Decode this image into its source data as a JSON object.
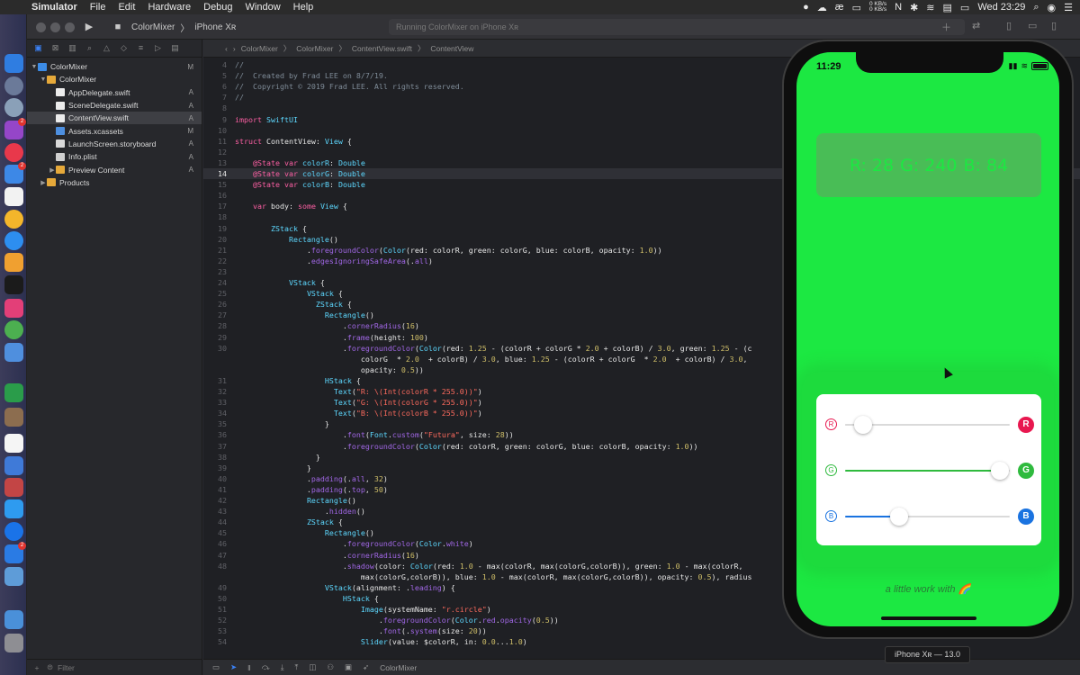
{
  "menubar": {
    "app_name": "Simulator",
    "items": [
      "File",
      "Edit",
      "Hardware",
      "Debug",
      "Window",
      "Help"
    ],
    "net_up": "0 KB/s",
    "net_down": "0 KB/s",
    "clock": "Wed 23:29"
  },
  "toolbar": {
    "scheme": "ColorMixer",
    "device": "iPhone Xʀ",
    "activity": "Running ColorMixer on iPhone Xʀ"
  },
  "navigator": {
    "filter_placeholder": "Filter",
    "items": [
      {
        "name": "ColorMixer",
        "status": "M"
      },
      {
        "name": "ColorMixer",
        "status": ""
      },
      {
        "name": "AppDelegate.swift",
        "status": "A"
      },
      {
        "name": "SceneDelegate.swift",
        "status": "A"
      },
      {
        "name": "ContentView.swift",
        "status": "A"
      },
      {
        "name": "Assets.xcassets",
        "status": "M"
      },
      {
        "name": "LaunchScreen.storyboard",
        "status": "A"
      },
      {
        "name": "Info.plist",
        "status": "A"
      },
      {
        "name": "Preview Content",
        "status": "A"
      },
      {
        "name": "Products",
        "status": ""
      }
    ]
  },
  "jumpbar": {
    "crumbs": [
      "ColorMixer",
      "ColorMixer",
      "ContentView.swift",
      "ContentView"
    ]
  },
  "editor": {
    "current_line": "14",
    "lines": [
      {
        "n": "4",
        "t": "//"
      },
      {
        "n": "5",
        "t": "//  Created by Frad LEE on 8/7/19."
      },
      {
        "n": "6",
        "t": "//  Copyright © 2019 Frad LEE. All rights reserved."
      },
      {
        "n": "7",
        "t": "//"
      },
      {
        "n": "8",
        "t": ""
      },
      {
        "n": "9",
        "t": "import SwiftUI"
      },
      {
        "n": "10",
        "t": ""
      },
      {
        "n": "11",
        "t": "struct ContentView: View {"
      },
      {
        "n": "12",
        "t": ""
      },
      {
        "n": "13",
        "t": "    @State var colorR: Double"
      },
      {
        "n": "14",
        "t": "    @State var colorG: Double"
      },
      {
        "n": "15",
        "t": "    @State var colorB: Double"
      },
      {
        "n": "16",
        "t": ""
      },
      {
        "n": "17",
        "t": "    var body: some View {"
      },
      {
        "n": "18",
        "t": ""
      },
      {
        "n": "19",
        "t": "        ZStack {"
      },
      {
        "n": "20",
        "t": "            Rectangle()"
      },
      {
        "n": "21",
        "t": "                .foregroundColor(Color(red: colorR, green: colorG, blue: colorB, opacity: 1.0))"
      },
      {
        "n": "22",
        "t": "                .edgesIgnoringSafeArea(.all)"
      },
      {
        "n": "23",
        "t": ""
      },
      {
        "n": "24",
        "t": "            VStack {"
      },
      {
        "n": "25",
        "t": "                VStack {"
      },
      {
        "n": "26",
        "t": "                  ZStack {"
      },
      {
        "n": "27",
        "t": "                    Rectangle()"
      },
      {
        "n": "28",
        "t": "                        .cornerRadius(16)"
      },
      {
        "n": "29",
        "t": "                        .frame(height: 100)"
      },
      {
        "n": "30",
        "t": "                        .foregroundColor(Color(red: 1.25 - (colorR + colorG * 2.0 + colorB) / 3.0, green: 1.25 - (c"
      },
      {
        "n": "",
        "t": "                            colorG  * 2.0  + colorB) / 3.0, blue: 1.25 - (colorR + colorG  * 2.0  + colorB) / 3.0,"
      },
      {
        "n": "",
        "t": "                            opacity: 0.5))"
      },
      {
        "n": "31",
        "t": "                    HStack {"
      },
      {
        "n": "32",
        "t": "                      Text(\"R: \\(Int(colorR * 255.0))\")"
      },
      {
        "n": "33",
        "t": "                      Text(\"G: \\(Int(colorG * 255.0))\")"
      },
      {
        "n": "34",
        "t": "                      Text(\"B: \\(Int(colorB * 255.0))\")"
      },
      {
        "n": "35",
        "t": "                    }"
      },
      {
        "n": "36",
        "t": "                        .font(Font.custom(\"Futura\", size: 28))"
      },
      {
        "n": "37",
        "t": "                        .foregroundColor(Color(red: colorR, green: colorG, blue: colorB, opacity: 1.0))"
      },
      {
        "n": "38",
        "t": "                  }"
      },
      {
        "n": "39",
        "t": "                }"
      },
      {
        "n": "40",
        "t": "                .padding(.all, 32)"
      },
      {
        "n": "41",
        "t": "                .padding(.top, 50)"
      },
      {
        "n": "42",
        "t": "                Rectangle()"
      },
      {
        "n": "43",
        "t": "                    .hidden()"
      },
      {
        "n": "44",
        "t": "                ZStack {"
      },
      {
        "n": "45",
        "t": "                    Rectangle()"
      },
      {
        "n": "46",
        "t": "                        .foregroundColor(Color.white)"
      },
      {
        "n": "47",
        "t": "                        .cornerRadius(16)"
      },
      {
        "n": "48",
        "t": "                        .shadow(color: Color(red: 1.0 - max(colorR, max(colorG,colorB)), green: 1.0 - max(colorR,"
      },
      {
        "n": "",
        "t": "                            max(colorG,colorB)), blue: 1.0 - max(colorR, max(colorG,colorB)), opacity: 0.5), radius"
      },
      {
        "n": "49",
        "t": "                    VStack(alignment: .leading) {"
      },
      {
        "n": "50",
        "t": "                        HStack {"
      },
      {
        "n": "51",
        "t": "                            Image(systemName: \"r.circle\")"
      },
      {
        "n": "52",
        "t": "                                .foregroundColor(Color.red.opacity(0.5))"
      },
      {
        "n": "53",
        "t": "                                .font(.system(size: 20))"
      },
      {
        "n": "54",
        "t": "                            Slider(value: $colorR, in: 0.0...1.0)"
      }
    ]
  },
  "statusbar": {
    "target": "ColorMixer"
  },
  "simulator": {
    "time": "11:29",
    "r_text": "R: 28",
    "g_text": "G: 240",
    "b_text": "B: 84",
    "sliders": [
      {
        "letter": "R",
        "color": "#e8174f",
        "fill": "#dadada",
        "value": 0.11
      },
      {
        "letter": "G",
        "color": "#2fba3e",
        "fill": "#2fba3e",
        "value": 0.94
      },
      {
        "letter": "B",
        "color": "#1a73e0",
        "fill": "#1a73e0",
        "value": 0.33
      }
    ],
    "footer": "a little work with 🌈",
    "device_label": "iPhone Xʀ — 13.0"
  },
  "colors": {
    "screen_bg": "#1ce842",
    "card_bg": "#49bd56",
    "keyword": "#fc5fa3",
    "type": "#5dd8ff",
    "string": "#fc6a5d",
    "number": "#d0bf69",
    "comment": "#7f8c98",
    "property": "#a167e6"
  }
}
